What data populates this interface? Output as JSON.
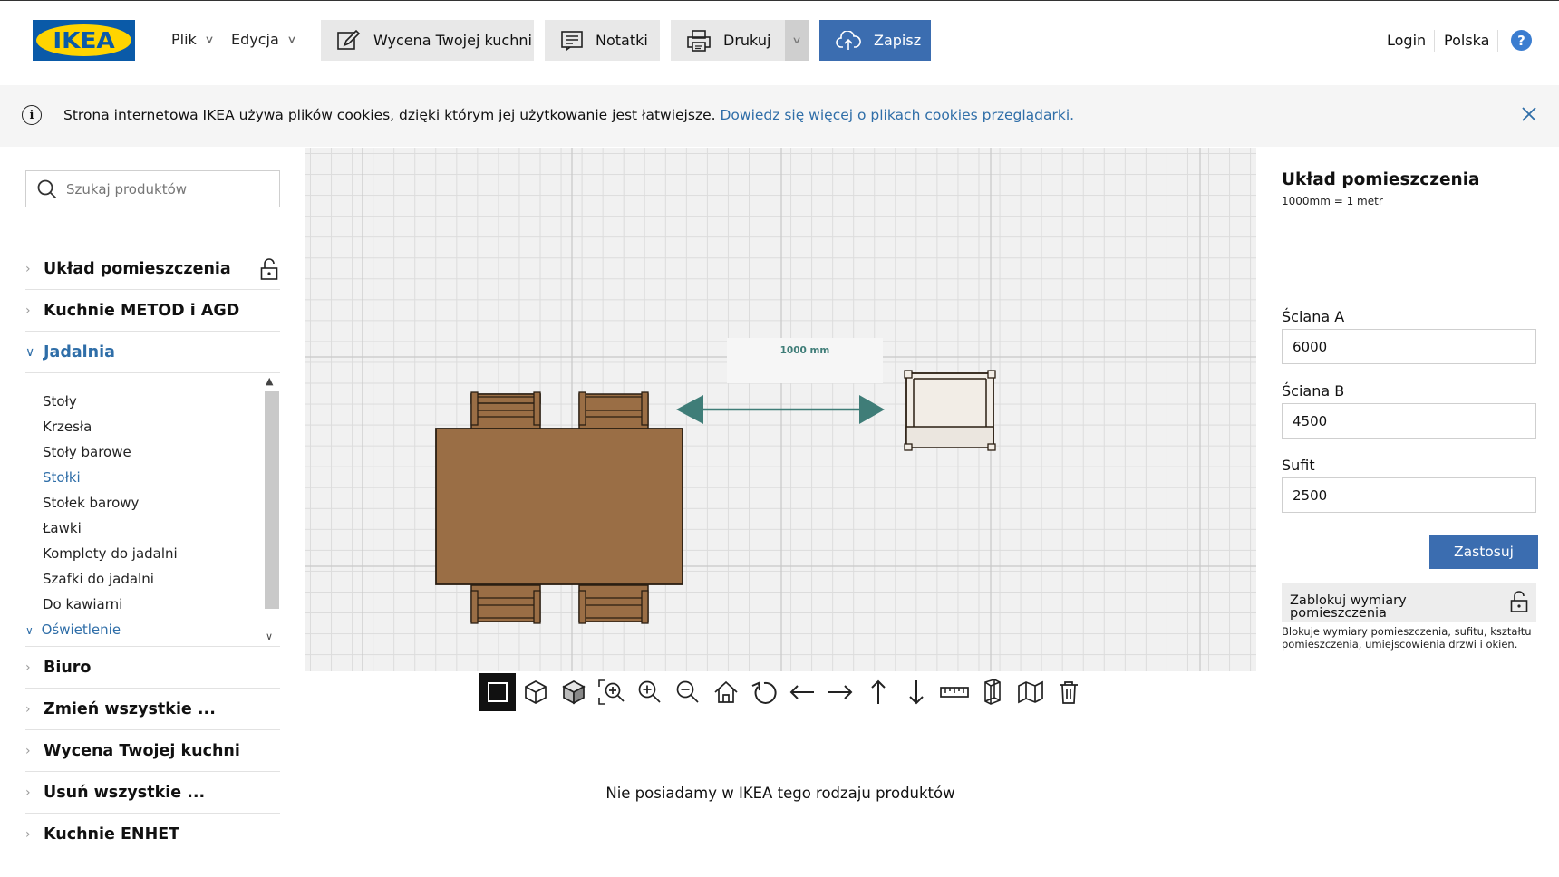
{
  "header": {
    "logo_text": "IKEA",
    "menu_file": "Plik",
    "menu_edit": "Edycja",
    "btn_quote": "Wycena Twojej kuchni",
    "btn_notes": "Notatki",
    "btn_print": "Drukuj",
    "btn_save": "Zapisz",
    "login": "Login",
    "country": "Polska",
    "help": "?"
  },
  "cookie": {
    "text": "Strona internetowa IKEA używa plików cookies, dzięki którym jej użytkowanie jest łatwiejsze.",
    "link": "Dowiedz się więcej o plikach cookies przeglądarki."
  },
  "sidebar": {
    "search_placeholder": "Szukaj produktów",
    "categories": [
      "Układ pomieszczenia",
      "Kuchnie METOD i AGD",
      "Jadalnia",
      "Biuro",
      "Zmień wszystkie ...",
      "Wycena Twojej kuchni",
      "Usuń wszystkie ...",
      "Kuchnie ENHET"
    ],
    "subitems": [
      "Stoły",
      "Krzesła",
      "Stoły barowe",
      "Stołki",
      "Stołek barowy",
      "Ławki",
      "Komplety do jadalni",
      "Szafki do jadalni",
      "Do kawiarni",
      "Oświetlenie"
    ]
  },
  "canvas": {
    "measure_label": "1000 mm"
  },
  "toolbar": {
    "tools": [
      "2d-view-icon",
      "3d-box-outline-icon",
      "3d-box-solid-icon",
      "zoom-fit-icon",
      "zoom-in-icon",
      "zoom-out-icon",
      "home-icon",
      "rotate-icon",
      "arrow-left-icon",
      "arrow-right-icon",
      "arrow-up-icon",
      "arrow-down-icon",
      "ruler-icon",
      "wall-icon",
      "room-icon",
      "trash-icon"
    ]
  },
  "main": {
    "empty_message": "Nie posiadamy w IKEA tego rodzaju produktów"
  },
  "right_panel": {
    "title": "Układ pomieszczenia",
    "scale": "1000mm = 1 metr",
    "wall_a_label": "Ściana A",
    "wall_a_value": "6000",
    "wall_b_label": "Ściana B",
    "wall_b_value": "4500",
    "ceiling_label": "Sufit",
    "ceiling_value": "2500",
    "apply": "Zastosuj",
    "lock_label": "Zablokuj wymiary pomieszczenia",
    "lock_desc": "Blokuje wymiary pomieszczenia, sufitu, kształtu pomieszczenia, umiejscowienia drzwi i okien."
  },
  "colors": {
    "ikea_blue": "#0a5aa8",
    "ikea_yellow": "#ffd400",
    "accent": "#3b6db0",
    "link": "#2f6ea8",
    "table_wood": "#9a6e45",
    "arrow_teal": "#3f7d78"
  }
}
